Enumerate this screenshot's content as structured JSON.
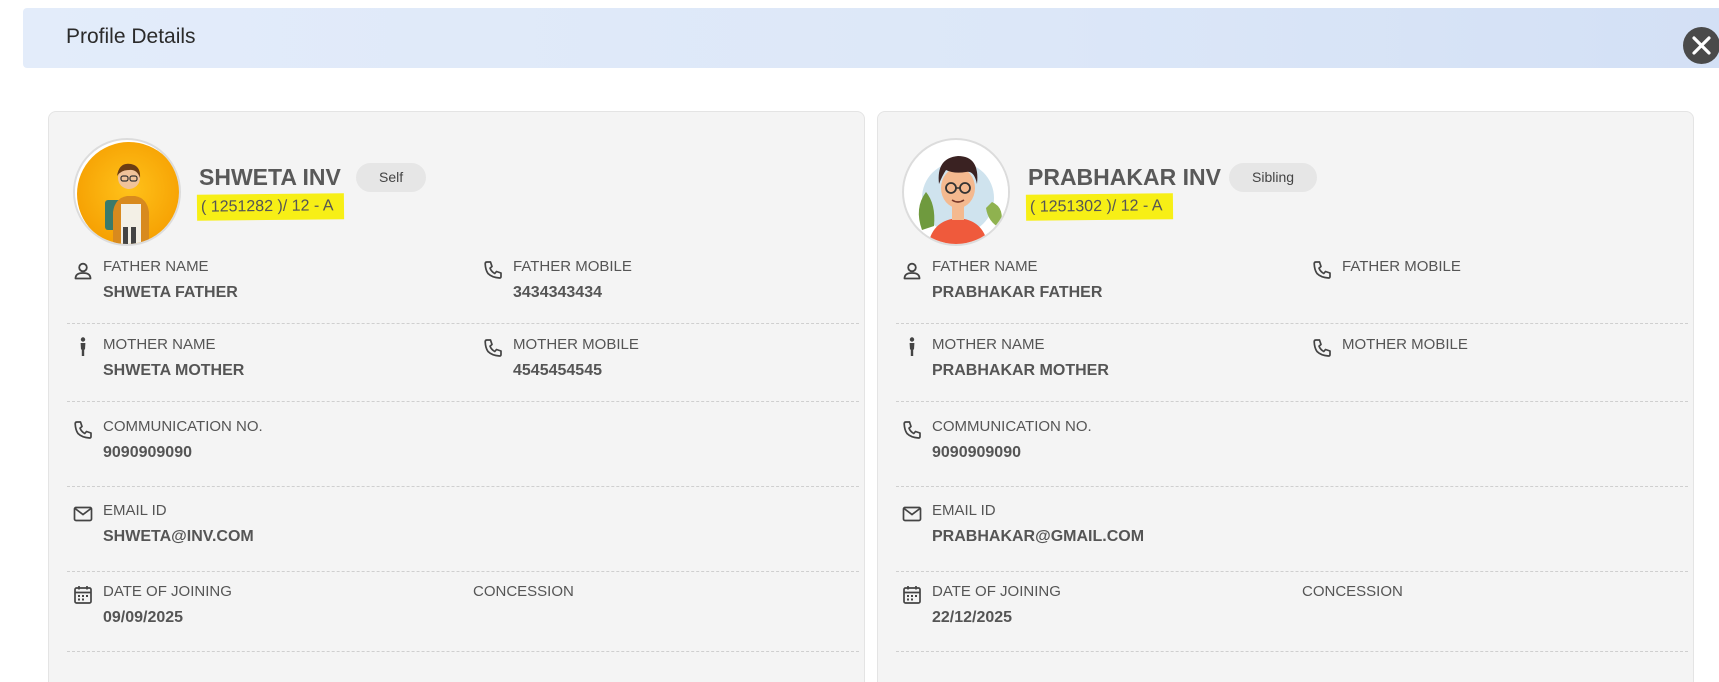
{
  "header": {
    "title": "Profile Details",
    "close_icon": "close-icon"
  },
  "cards": [
    {
      "name": "SHWETA INV",
      "relation": "Self",
      "id_line": "( 1251282 )/ 12 - A",
      "father_name_label": "FATHER NAME",
      "father_name": "SHWETA FATHER",
      "father_mobile_label": "FATHER MOBILE",
      "father_mobile": "3434343434",
      "mother_name_label": "MOTHER NAME",
      "mother_name": "SHWETA MOTHER",
      "mother_mobile_label": "MOTHER MOBILE",
      "mother_mobile": "4545454545",
      "communication_label": "COMMUNICATION NO.",
      "communication": "9090909090",
      "email_label": "EMAIL ID",
      "email": "SHWETA@INV.COM",
      "doj_label": "DATE OF JOINING",
      "doj": "09/09/2025",
      "concession_label": "CONCESSION",
      "concession": ""
    },
    {
      "name": "PRABHAKAR INV",
      "relation": "Sibling",
      "id_line": "( 1251302 )/ 12 - A",
      "father_name_label": "FATHER NAME",
      "father_name": "PRABHAKAR FATHER",
      "father_mobile_label": "FATHER MOBILE",
      "father_mobile": "",
      "mother_name_label": "MOTHER NAME",
      "mother_name": "PRABHAKAR MOTHER",
      "mother_mobile_label": "MOTHER MOBILE",
      "mother_mobile": "",
      "communication_label": "COMMUNICATION NO.",
      "communication": "9090909090",
      "email_label": "EMAIL ID",
      "email": "PRABHAKAR@GMAIL.COM",
      "doj_label": "DATE OF JOINING",
      "doj": "22/12/2025",
      "concession_label": "CONCESSION",
      "concession": ""
    }
  ],
  "colors": {
    "highlight": "#f7ef16",
    "card_bg": "#f4f4f4",
    "header_bg": "#dce7f8"
  }
}
